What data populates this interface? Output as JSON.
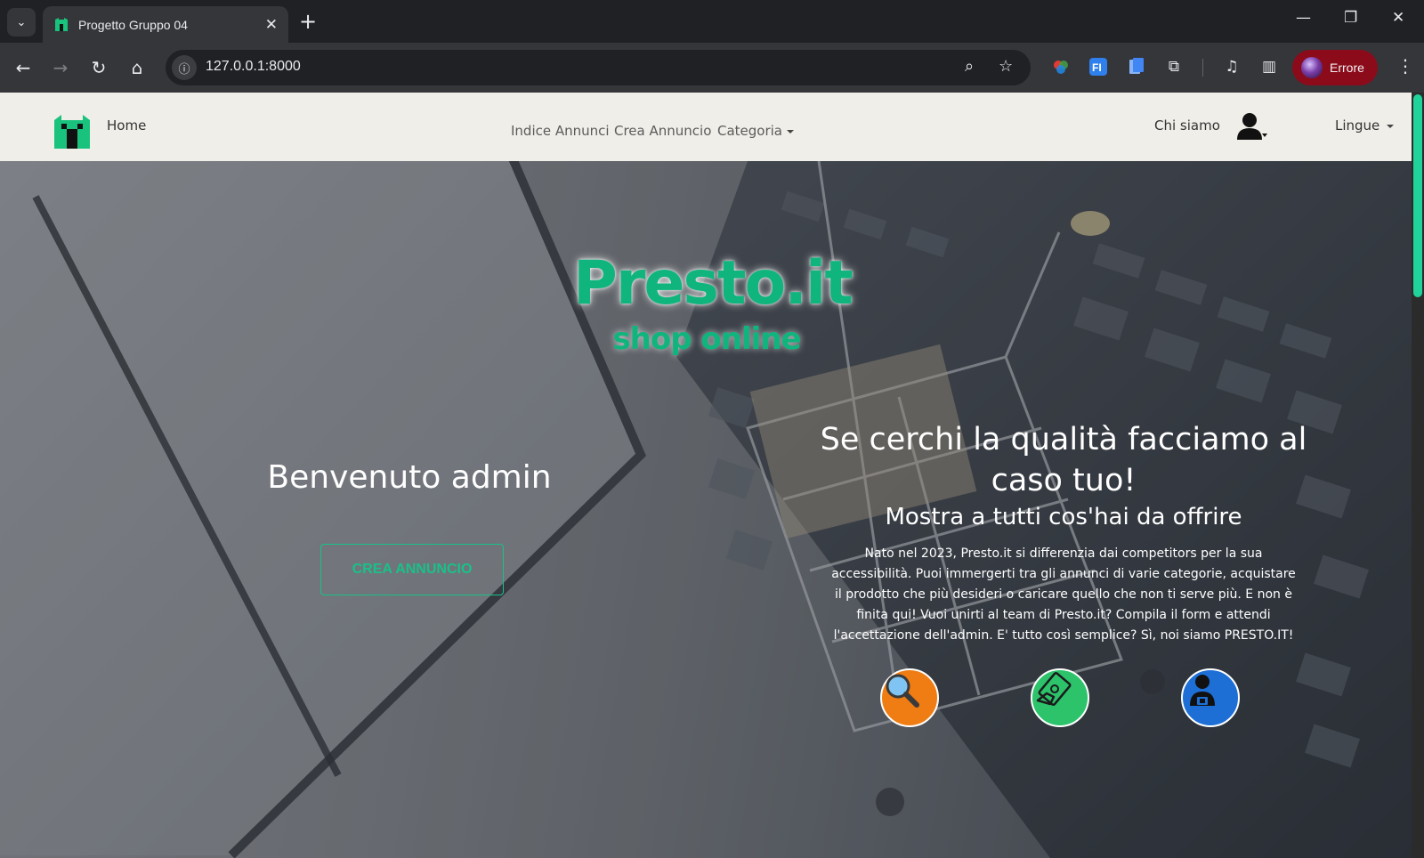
{
  "browser": {
    "tab_title": "Progetto Gruppo 04",
    "url": "127.0.0.1:8000",
    "profile_label": "Errore"
  },
  "navbar": {
    "home": "Home",
    "links": [
      "Indice Annunci",
      "Crea Annuncio",
      "Categoria"
    ],
    "about": "Chi siamo",
    "languages": "Lingue"
  },
  "hero": {
    "brand": "Presto.it",
    "brand_sub": "shop online",
    "welcome": "Benvenuto admin",
    "cta": "CREA ANNUNCIO",
    "headline": "Se cerchi la qualità facciamo al caso tuo!",
    "subheadline": "Mostra a tutti cos'hai da offrire",
    "description": "Nato nel 2023, Presto.it si differenzia dai competitors per la sua accessibilità. Puoi immergerti tra gli annunci di varie categorie, acquistare il prodotto che più desideri o caricare quello che non ti serve più. E non è finita qui! Vuoi unirti al team di Presto.it? Compila il form e attendi l'accettazione dell'admin. E' tutto così semplice? Sì, noi siamo PRESTO.IT!"
  },
  "features": [
    {
      "icon": "search-icon",
      "color": "#ef7d14"
    },
    {
      "icon": "handshake-money-icon",
      "color": "#2cc36b"
    },
    {
      "icon": "user-lock-icon",
      "color": "#1d6fd6"
    }
  ],
  "colors": {
    "accent": "#18c188",
    "navbar_bg": "#f0eee8"
  }
}
